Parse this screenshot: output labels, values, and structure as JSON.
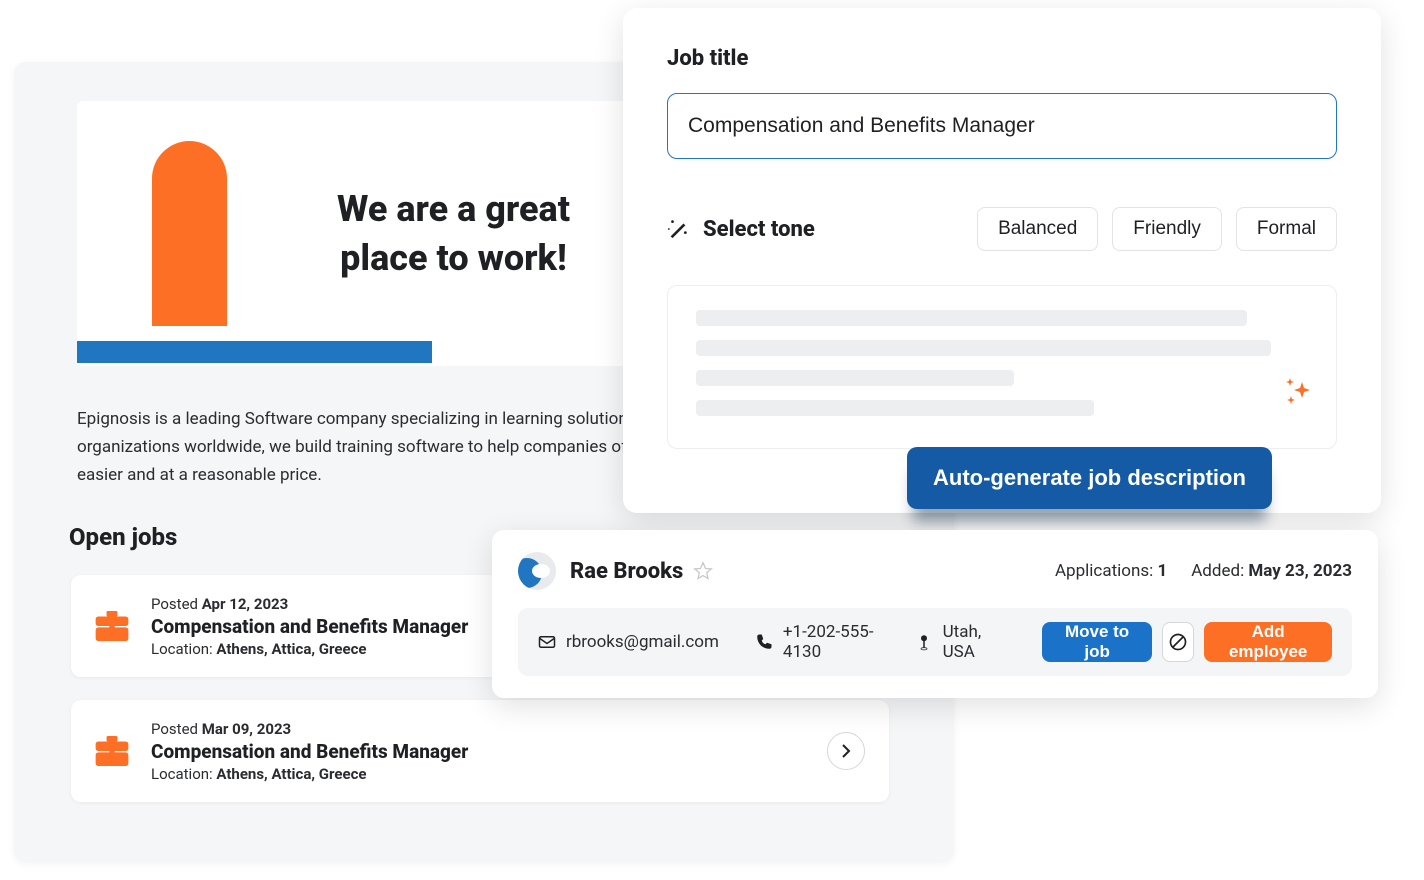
{
  "hero": {
    "title_line1": "We are a great",
    "title_line2": "place to work!"
  },
  "description": "Epignosis is a leading Software company specializing in learning solutions. Trusted by thousands of organizations worldwide, we build training software to help companies of all sizes deliver online training easier and at a reasonable price.",
  "open_jobs_heading": "Open jobs",
  "jobs": [
    {
      "posted_label": "Posted ",
      "posted_date": "Apr 12, 2023",
      "title": "Compensation and Benefits Manager",
      "location_label": "Location: ",
      "location": "Athens, Attica, Greece"
    },
    {
      "posted_label": "Posted ",
      "posted_date": "Mar 09, 2023",
      "title": "Compensation and Benefits Manager",
      "location_label": "Location: ",
      "location": "Athens, Attica, Greece"
    }
  ],
  "modal": {
    "label": "Job title",
    "input_value": "Compensation and Benefits Manager",
    "tone_label": "Select tone",
    "tones": [
      "Balanced",
      "Friendly",
      "Formal"
    ]
  },
  "autogen_label": "Auto-generate job description",
  "candidate": {
    "name": "Rae Brooks",
    "applications_label": "Applications: ",
    "applications_count": "1",
    "added_label": "Added: ",
    "added_date": "May 23, 2023",
    "email": "rbrooks@gmail.com",
    "phone": "+1-202-555-4130",
    "location": "Utah, USA",
    "move_label": "Move to job",
    "add_label": "Add employee"
  },
  "colors": {
    "orange": "#fc6f25",
    "blue": "#1a73c9",
    "darkblue": "#145aa4"
  }
}
